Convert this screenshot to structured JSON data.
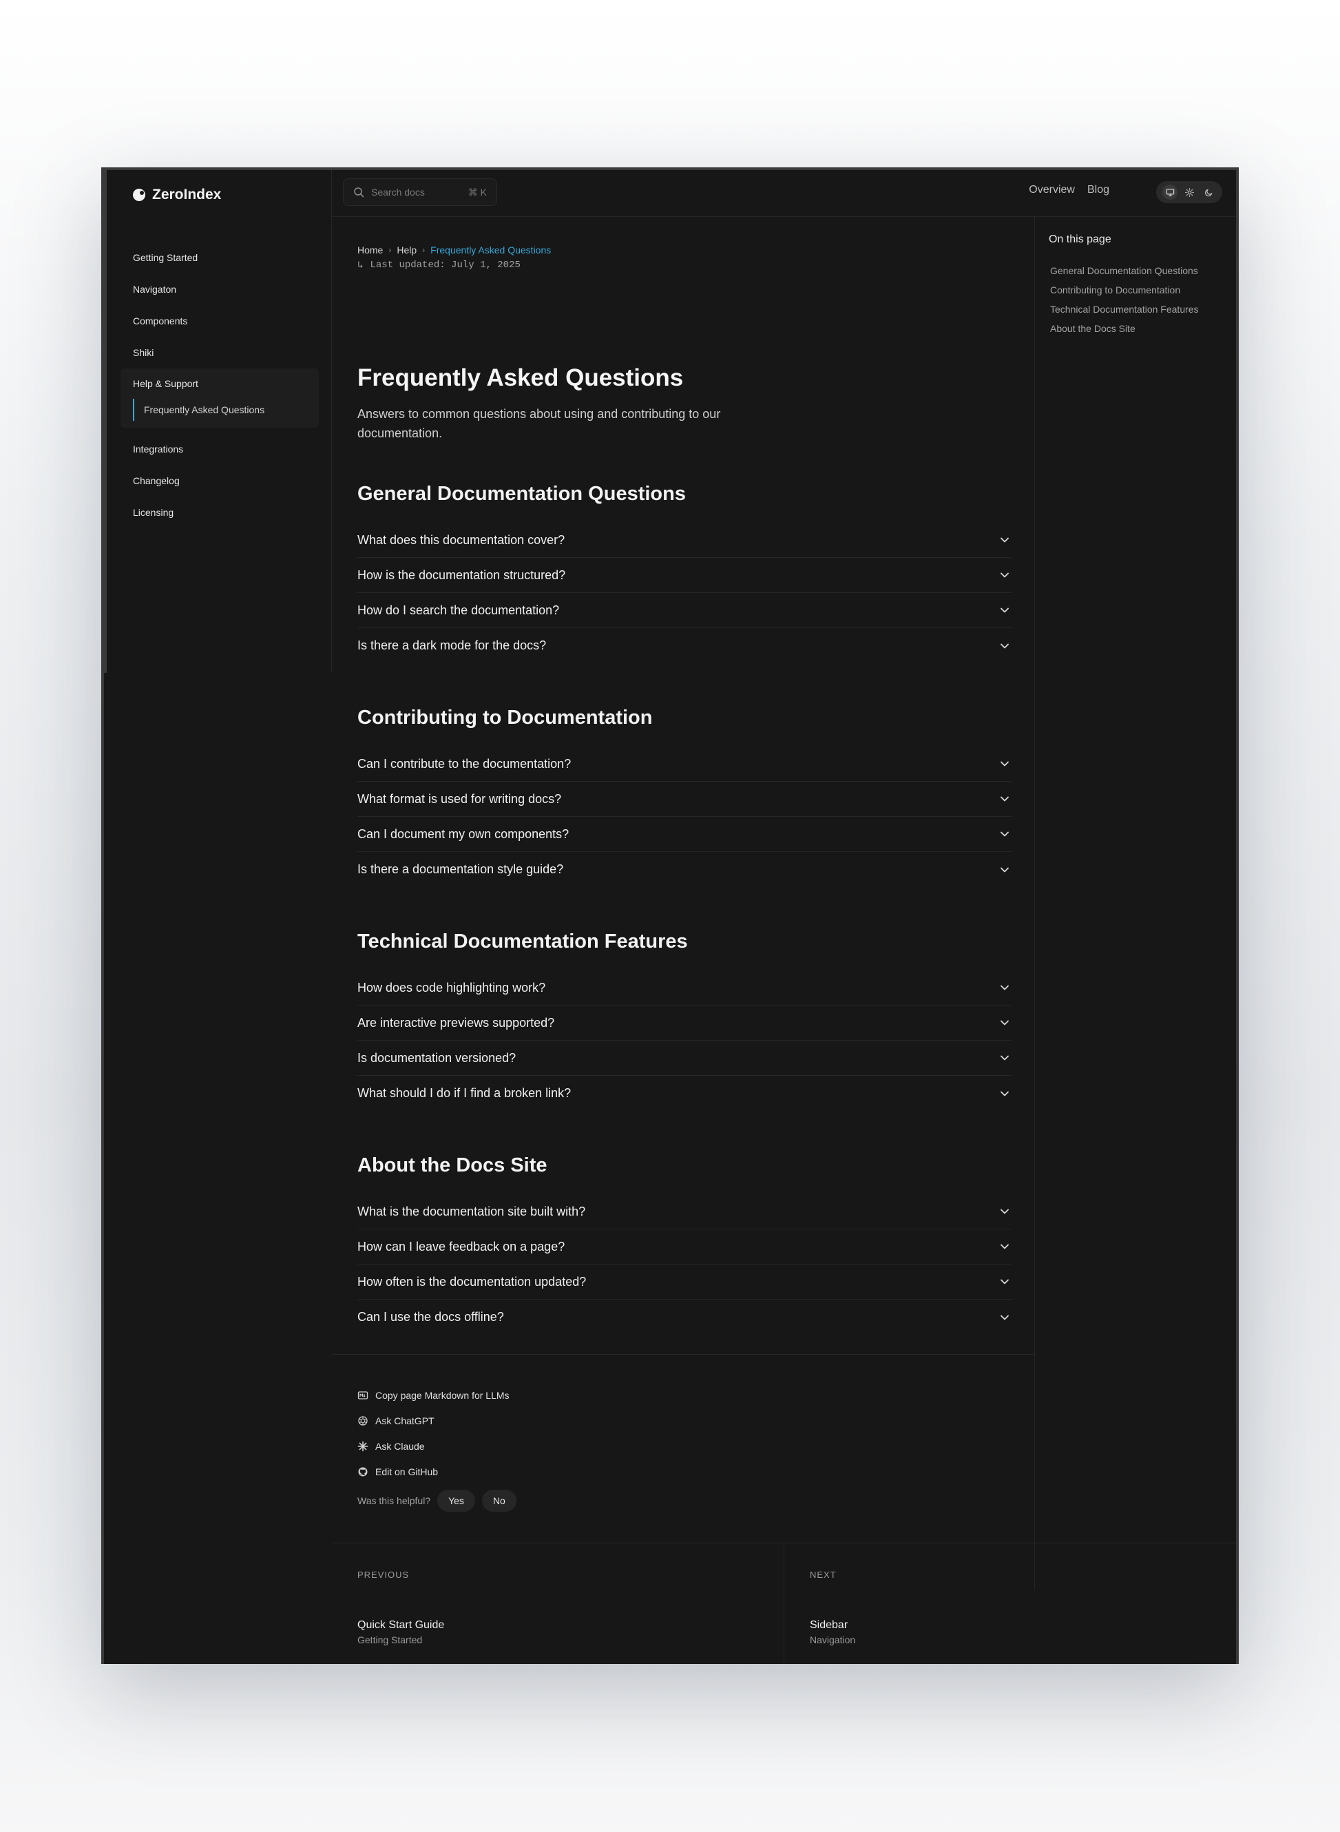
{
  "brand": {
    "name": "ZeroIndex"
  },
  "sidebar": {
    "items": [
      {
        "label": "Getting Started"
      },
      {
        "label": "Navigaton"
      },
      {
        "label": "Components"
      },
      {
        "label": "Shiki"
      }
    ],
    "group": {
      "label": "Help & Support",
      "sub": "Frequently Asked Questions"
    },
    "items_after": [
      {
        "label": "Integrations"
      },
      {
        "label": "Changelog"
      },
      {
        "label": "Licensing"
      }
    ]
  },
  "topbar": {
    "search_placeholder": "Search docs",
    "search_shortcut": "⌘ K",
    "links": [
      "Overview",
      "Blog"
    ]
  },
  "breadcrumb": [
    "Home",
    "Help",
    "Frequently Asked Questions"
  ],
  "updated": "Last updated: July 1, 2025",
  "page": {
    "title": "Frequently Asked Questions",
    "description": "Answers to common questions about using and contributing to our documentation."
  },
  "sections": [
    {
      "title": "General Documentation Questions",
      "questions": [
        "What does this documentation cover?",
        "How is the documentation structured?",
        "How do I search the documentation?",
        "Is there a dark mode for the docs?"
      ]
    },
    {
      "title": "Contributing to Documentation",
      "questions": [
        "Can I contribute to the documentation?",
        "What format is used for writing docs?",
        "Can I document my own components?",
        "Is there a documentation style guide?"
      ]
    },
    {
      "title": "Technical Documentation Features",
      "questions": [
        "How does code highlighting work?",
        "Are interactive previews supported?",
        "Is documentation versioned?",
        "What should I do if I find a broken link?"
      ]
    },
    {
      "title": "About the Docs Site",
      "questions": [
        "What is the documentation site built with?",
        "How can I leave feedback on a page?",
        "How often is the documentation updated?",
        "Can I use the docs offline?"
      ]
    }
  ],
  "toc": {
    "title": "On this page",
    "items": [
      "General Documentation Questions",
      "Contributing to Documentation",
      "Technical Documentation Features",
      "About the Docs Site"
    ]
  },
  "actions": {
    "copy": "Copy page Markdown for LLMs",
    "chatgpt": "Ask ChatGPT",
    "claude": "Ask Claude",
    "github": "Edit on GitHub",
    "helpful_q": "Was this helpful?",
    "yes": "Yes",
    "no": "No"
  },
  "pager": {
    "prev": {
      "label": "PREVIOUS",
      "title": "Quick Start Guide",
      "sub": "Getting Started"
    },
    "next": {
      "label": "NEXT",
      "title": "Sidebar",
      "sub": "Navigation"
    }
  },
  "colors": {
    "accent": "#38a8d8",
    "background": "#171717"
  }
}
